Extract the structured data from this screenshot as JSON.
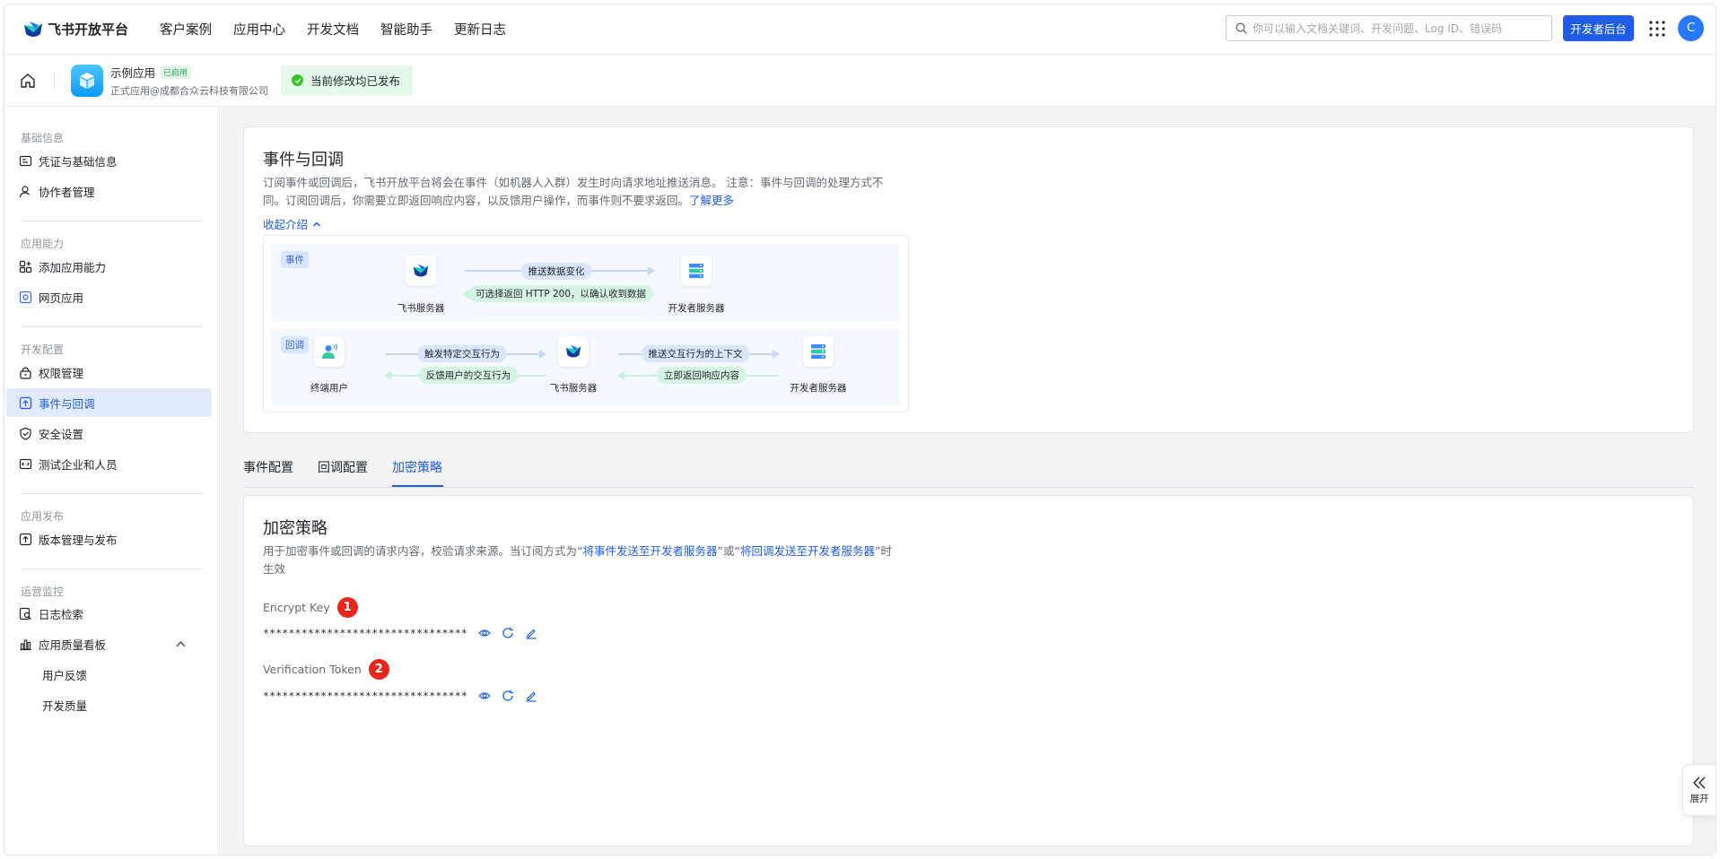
{
  "topnav": {
    "brand": "飞书开放平台",
    "links": [
      "客户案例",
      "应用中心",
      "开发文档",
      "智能助手",
      "更新日志"
    ],
    "search_placeholder": "你可以输入文档关键词、开发问题、Log ID、错误码",
    "dev_console": "开发者后台",
    "avatar_letter": "C"
  },
  "appbar": {
    "app_name": "示例应用",
    "app_badge": "已启用",
    "app_sub": "正式应用@成都合众云科技有限公司",
    "publish_status": "当前修改均已发布"
  },
  "sidebar": {
    "groups": [
      "基础信息",
      "应用能力",
      "开发配置",
      "应用发布",
      "运营监控"
    ],
    "items": {
      "credentials": "凭证与基础信息",
      "collaborators": "协作者管理",
      "add_capability": "添加应用能力",
      "web_app": "网页应用",
      "permissions": "权限管理",
      "events": "事件与回调",
      "security": "安全设置",
      "test_enterprise": "测试企业和人员",
      "version": "版本管理与发布",
      "log_search": "日志检索",
      "quality_board": "应用质量看板",
      "user_feedback": "用户反馈",
      "dev_quality": "开发质量"
    }
  },
  "intro": {
    "title": "事件与回调",
    "desc_line1": "订阅事件或回调后，飞书开放平台将会在事件（如机器人入群）发生时向请求地址推送消息。 注意：事件与回调的处理方式不",
    "desc_line2": "同。订阅回调后，你需要立即返回响应内容，以反馈用户操作，而事件则不要求返回。",
    "learn_more": "了解更多",
    "collapse": "收起介绍"
  },
  "diagram": {
    "event_tag": "事件",
    "callback_tag": "回调",
    "feishu_server": "飞书服务器",
    "dev_server": "开发者服务器",
    "end_user": "终端用户",
    "push_change": "推送数据变化",
    "return_200": "可选择返回 HTTP 200，以确认收到数据",
    "trigger_action": "触发特定交互行为",
    "feedback_action": "反馈用户的交互行为",
    "push_context": "推送交互行为的上下文",
    "return_immediately": "立即返回响应内容"
  },
  "tabs": [
    "事件配置",
    "回调配置",
    "加密策略"
  ],
  "encryption": {
    "title": "加密策略",
    "desc_prefix": "用于加密事件或回调的请求内容，校验请求来源。当订阅方式为“",
    "desc_link1": "将事件发送至开发者服务器",
    "desc_mid": "”或“",
    "desc_link2": "将回调发送至开发者服务器",
    "desc_suffix": "”时",
    "desc_line2": "生效",
    "encrypt_key_label": "Encrypt Key",
    "encrypt_key_marker": "1",
    "encrypt_key_value": "********************************",
    "token_label": "Verification Token",
    "token_marker": "2",
    "token_value": "********************************"
  },
  "expand": {
    "label": "展开"
  },
  "colors": {
    "accent": "#1f5de6",
    "marker": "#e8261c",
    "success": "#34c724"
  }
}
